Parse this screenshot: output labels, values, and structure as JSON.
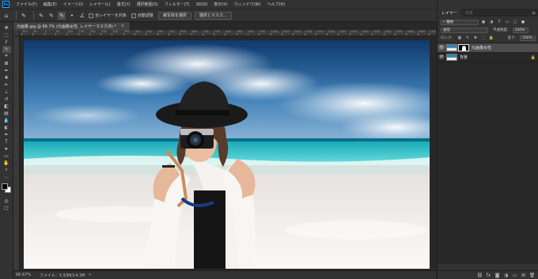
{
  "app": {
    "logo_text": "Ps"
  },
  "menu": [
    "ファイル(F)",
    "編集(E)",
    "イメージ(I)",
    "レイヤー(L)",
    "書式(Y)",
    "選択範囲(S)",
    "フィルター(T)",
    "3D(D)",
    "表示(V)",
    "ウィンドウ(W)",
    "ヘルプ(H)"
  ],
  "window_controls": [
    "—",
    "☐",
    "✕"
  ],
  "options": {
    "sample_all_layers": "全レイヤーを対象",
    "auto_enhance": "自動調整",
    "select_subject": "被写体を選択",
    "select_and_mask": "選択とマスク..."
  },
  "document_tab": {
    "title": "元画像.jpg @ 66.7% (元画像女性, レイヤーマスク/8) *",
    "close": "×"
  },
  "ruler_labels": [
    "100",
    "50",
    "0",
    "50",
    "100",
    "150",
    "200",
    "250",
    "300",
    "350",
    "400",
    "450",
    "500",
    "550",
    "600",
    "650",
    "700",
    "750",
    "800",
    "850",
    "900",
    "950",
    "1000",
    "1050",
    "1100",
    "1150",
    "1200",
    "1250",
    "1300",
    "1350",
    "1400",
    "1450",
    "1500",
    "1550",
    "1600",
    "1650",
    "1700"
  ],
  "status": {
    "zoom": "66.67%",
    "doc_info": "ファイル：5.93M/14.3M",
    "arrow": ">"
  },
  "panels": {
    "tabs": [
      "レイヤー",
      "パス"
    ],
    "kind_filter": "種類",
    "blend_mode": "通常",
    "opacity_label": "不透明度：",
    "opacity_value": "100%",
    "lock_label": "ロック：",
    "fill_label": "塗り：",
    "fill_value": "100%",
    "layers": [
      {
        "name": "元画像女性",
        "selected": true
      },
      {
        "name": "背景",
        "selected": false
      }
    ]
  },
  "colors": {
    "accent": "#31a8ff",
    "panel_bg": "#323232",
    "canvas_bg": "#282828"
  },
  "icons": {
    "toolbox": [
      "move-icon",
      "marquee-icon",
      "lasso-icon",
      "quick-select-icon",
      "crop-icon",
      "frame-icon",
      "eyedropper-icon",
      "spot-heal-icon",
      "brush-icon",
      "clone-stamp-icon",
      "history-brush-icon",
      "eraser-icon",
      "gradient-icon",
      "blur-icon",
      "dodge-icon",
      "pen-icon",
      "type-icon",
      "path-select-icon",
      "shape-icon",
      "hand-icon",
      "zoom-icon",
      "more-tools-icon"
    ]
  }
}
